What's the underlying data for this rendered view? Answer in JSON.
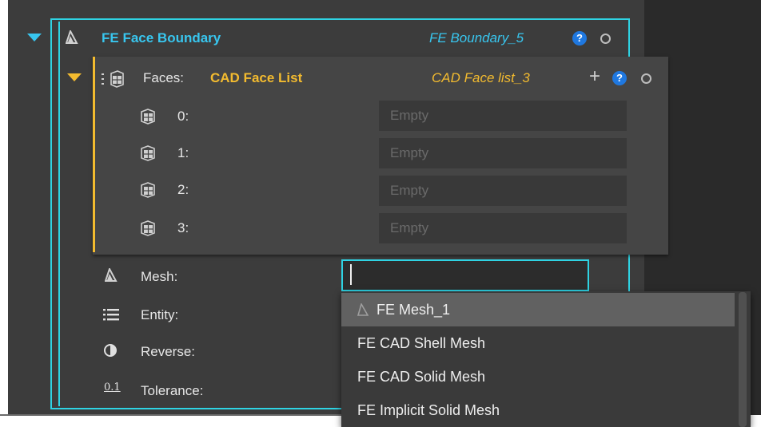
{
  "boundary": {
    "title": "FE Face Boundary",
    "instance": "FE Boundary_5",
    "help": "?"
  },
  "faces": {
    "label": "Faces:",
    "type": "CAD Face List",
    "instance": "CAD Face list_3",
    "add": "+",
    "help": "?",
    "items": [
      {
        "index": "0:",
        "value": "Empty"
      },
      {
        "index": "1:",
        "value": "Empty"
      },
      {
        "index": "2:",
        "value": "Empty"
      },
      {
        "index": "3:",
        "value": "Empty"
      }
    ]
  },
  "props": {
    "mesh": "Mesh:",
    "entity": "Entity:",
    "reverse": "Reverse:",
    "tolerance": "Tolerance:",
    "tolerance_icon": "0.1"
  },
  "dropdown": {
    "items": [
      "FE Mesh_1",
      "FE CAD Shell Mesh",
      "FE CAD Solid Mesh",
      "FE Implicit Solid Mesh"
    ]
  },
  "colors": {
    "accent": "#2fd3e3",
    "title": "#38c6ef",
    "faces": "#f3bb2f",
    "help": "#1f78e0"
  }
}
